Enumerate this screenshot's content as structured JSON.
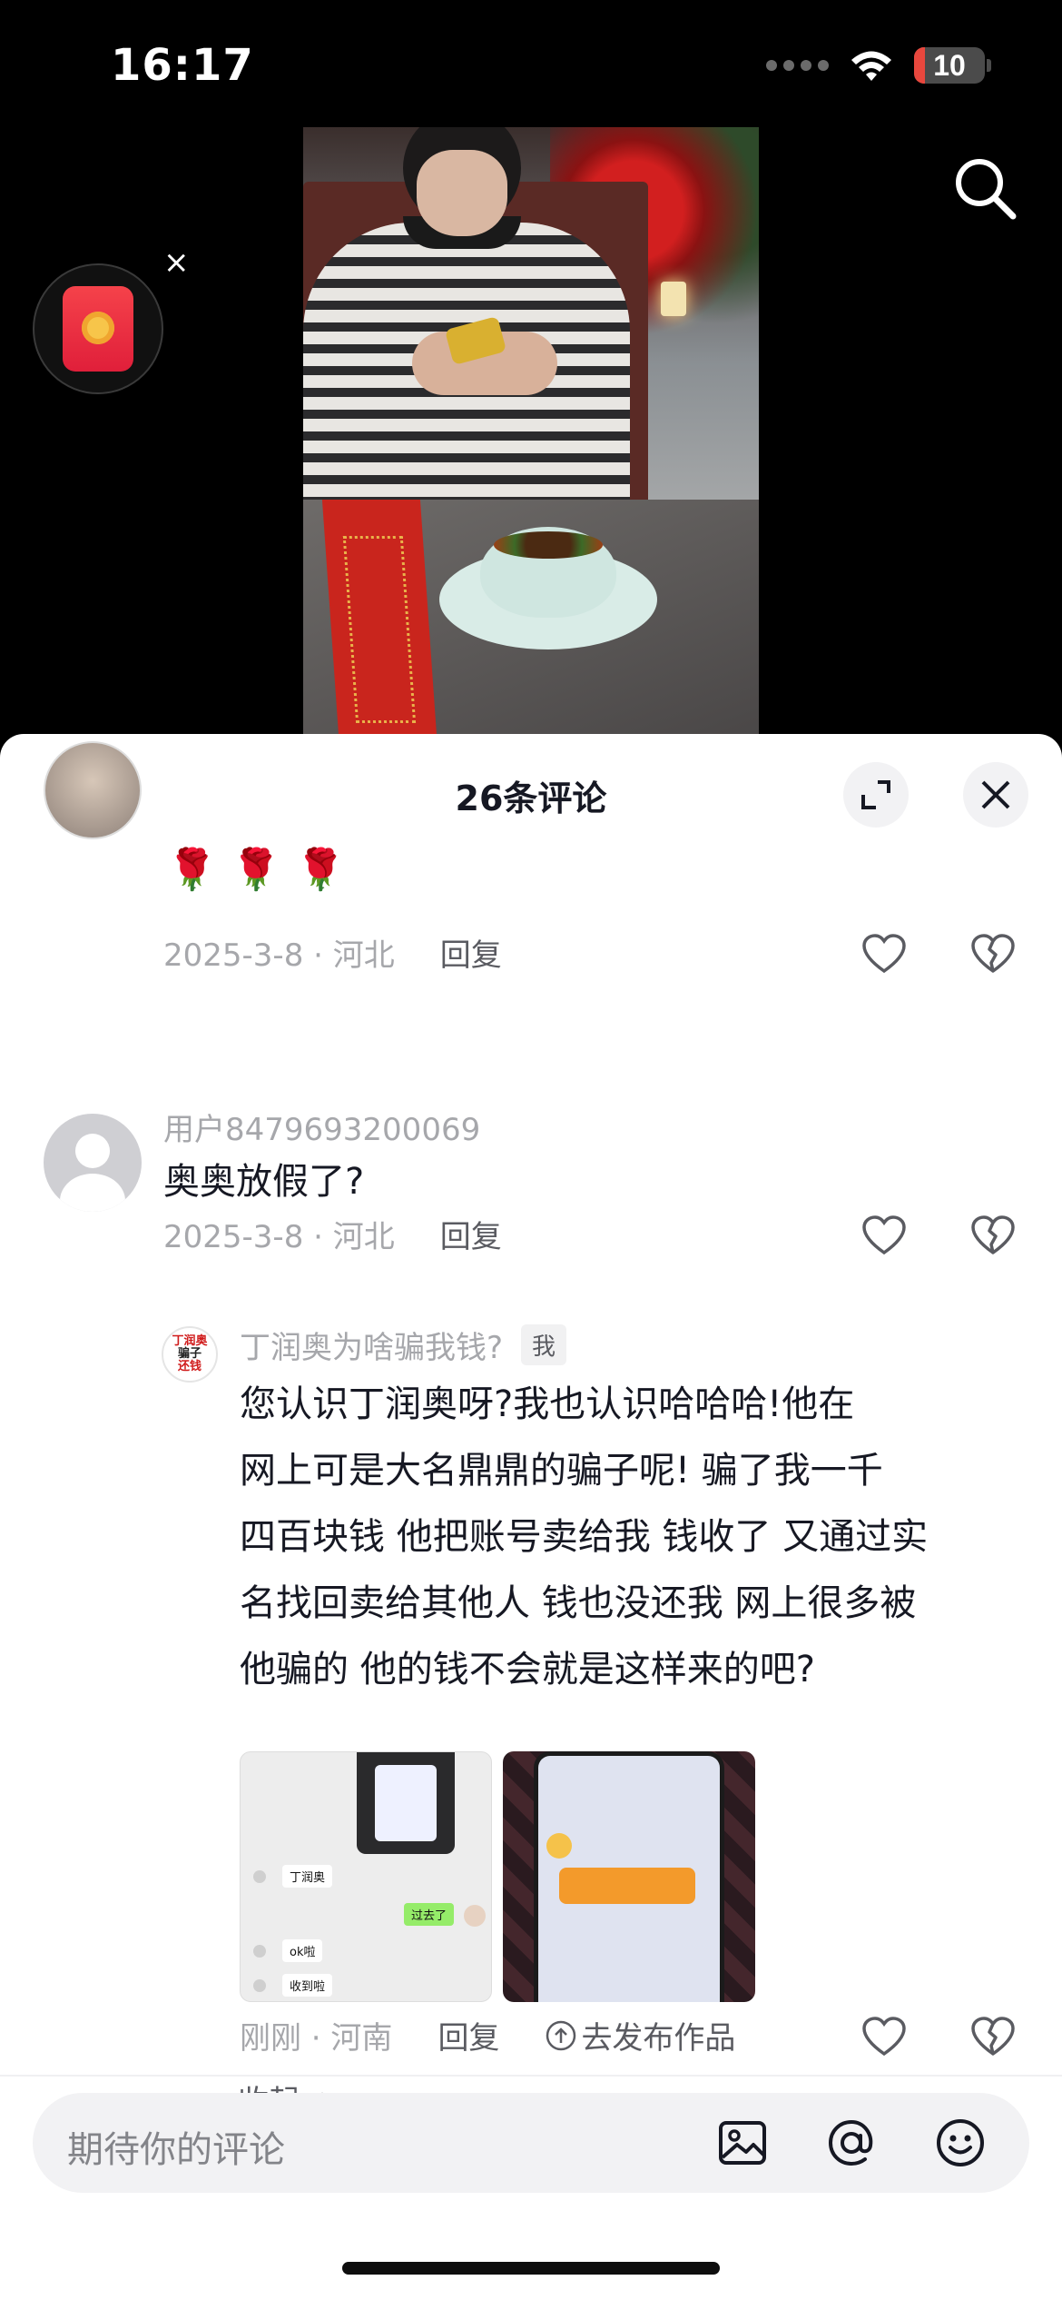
{
  "status_bar": {
    "time": "16:17",
    "battery_level": "10",
    "icons": [
      "signal-dots-icon",
      "wifi-icon",
      "battery-icon"
    ]
  },
  "video": {
    "search_icon": "search-icon",
    "red_packet_icon": "red-packet-icon",
    "close_icon": "close-icon",
    "close_symbol": "×"
  },
  "sheet": {
    "title": "26条评论",
    "expand_icon": "expand-icon",
    "close_icon": "close-icon"
  },
  "comments": [
    {
      "text": "🌹🌹🌹",
      "date": "2025-3-8",
      "location": "河北",
      "date_location": "2025-3-8 · 河北",
      "reply_label": "回复"
    },
    {
      "user": "用户8479693200069",
      "text": "奥奥放假了?",
      "date_location": "2025-3-8 · 河北",
      "reply_label": "回复",
      "replies": [
        {
          "user": "丁润奥为啥骗我钱?",
          "tag": "我",
          "avatar_text": [
            "丁润奥",
            "骗子",
            "还钱"
          ],
          "lines": [
            "您认识丁润奥呀?我也认识哈哈哈!他在",
            "网上可是大名鼎鼎的骗子呢! 骗了我一千",
            "四百块钱 他把账号卖给我 钱收了 又通过实",
            "名找回卖给其他人 钱也没还我 网上很多被",
            "他骗的 他的钱不会就是这样来的吧?"
          ],
          "image1_bubbles": [
            "丁润奥",
            "过去了",
            "ok啦",
            "收到啦"
          ],
          "time_location": "刚刚 · 河南",
          "reply_label": "回复",
          "publish_label": "去发布作品"
        }
      ]
    }
  ],
  "collapse_label": "收起",
  "input": {
    "placeholder": "期待你的评论",
    "icons": [
      "image-icon",
      "at-icon",
      "emoji-icon"
    ]
  },
  "colors": {
    "primary_text": "#161823",
    "muted_text": "#a6a7ab",
    "sheet_bg": "#ffffff",
    "screen_bg": "#000000"
  }
}
